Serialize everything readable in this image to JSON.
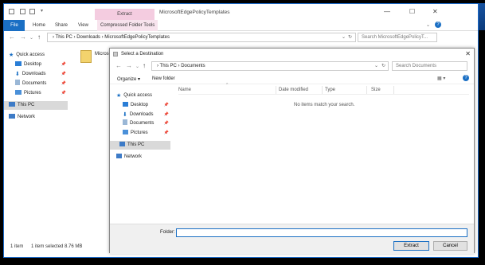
{
  "colors": {
    "accent": "#1a6fc4",
    "extract_tab": "#f4cce0",
    "selected": "#d9d9d9"
  },
  "explorer": {
    "title": "MicrosoftEdgePolicyTemplates",
    "contextual_tab": "Extract",
    "ribbon_tabs": [
      "File",
      "Home",
      "Share",
      "View",
      "Compressed Folder Tools"
    ],
    "breadcrumb": "›  This PC  ›  Downloads  ›  MicrosoftEdgePolicyTemplates",
    "search_placeholder": "Search MicrosoftEdgePolicyT...",
    "nav": {
      "quick_access": "Quick access",
      "desktop": "Desktop",
      "downloads": "Downloads",
      "documents": "Documents",
      "pictures": "Pictures",
      "this_pc": "This PC",
      "network": "Network"
    },
    "file_name": "Microso",
    "status": {
      "items": "1 item",
      "selected": "1 item selected  8.76 MB"
    }
  },
  "dialog": {
    "title": "Select a Destination",
    "breadcrumb": "›  This PC  ›  Documents",
    "search_placeholder": "Search Documents",
    "organize": "Organize ▾",
    "new_folder": "New folder",
    "nav": {
      "quick_access": "Quick access",
      "desktop": "Desktop",
      "downloads": "Downloads",
      "documents": "Documents",
      "pictures": "Pictures",
      "this_pc": "This PC",
      "network": "Network"
    },
    "columns": {
      "name": "Name",
      "date_modified": "Date modified",
      "type": "Type",
      "size": "Size"
    },
    "empty_message": "No items match your search.",
    "folder_label": "Folder:",
    "folder_value": "",
    "extract_button": "Extract",
    "cancel_button": "Cancel"
  }
}
